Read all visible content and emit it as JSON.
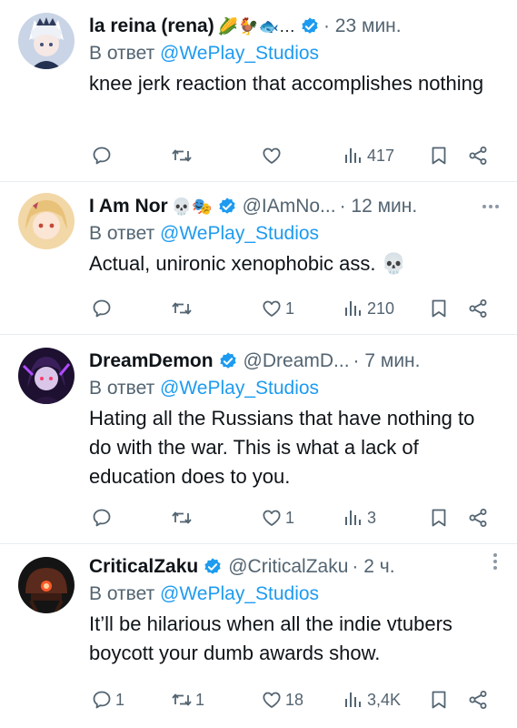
{
  "tweets": [
    {
      "name": "la reina (rena)",
      "emoji": "🌽🐓🐟…",
      "handle": "",
      "time": "· 23 мин.",
      "reply_prefix": "В ответ ",
      "reply_to": "@WePlay_Studios",
      "text": "knee jerk reaction that accomplishes nothing",
      "replies": "",
      "retweets": "",
      "likes": "",
      "views": "417"
    },
    {
      "name": "I Am Nor",
      "emoji": "💀🎭",
      "handle": "@IAmNo...",
      "time": "· 12 мин.",
      "reply_prefix": "В ответ ",
      "reply_to": "@WePlay_Studios",
      "text": "Actual, unironic xenophobic ass. 💀",
      "replies": "",
      "retweets": "",
      "likes": "1",
      "views": "210"
    },
    {
      "name": "DreamDemon",
      "emoji": "",
      "handle": "@DreamD...",
      "time": "· 7 мин.",
      "reply_prefix": "В ответ ",
      "reply_to": "@WePlay_Studios",
      "text": "Hating all the Russians that have nothing to do with the war. This is what a lack of education does to you.",
      "replies": "",
      "retweets": "",
      "likes": "1",
      "views": "3"
    },
    {
      "name": "CriticalZaku",
      "emoji": "",
      "handle": "@CriticalZaku",
      "time": "· 2 ч.",
      "reply_prefix": "В ответ ",
      "reply_to": "@WePlay_Studios",
      "text": "It’ll be hilarious when all the indie vtubers boycott your dumb awards show.",
      "replies": "1",
      "retweets": "1",
      "likes": "18",
      "views": "3,4K"
    }
  ],
  "colors": {
    "text": "#0f1419",
    "secondary": "#536471",
    "link": "#1d9bf0",
    "verified": "#1d9bf0",
    "divider": "#e6ecf0"
  },
  "icons": [
    "reply-icon",
    "retweet-icon",
    "like-icon",
    "views-icon",
    "bookmark-icon",
    "share-icon",
    "verified-badge-icon",
    "more-icon"
  ]
}
